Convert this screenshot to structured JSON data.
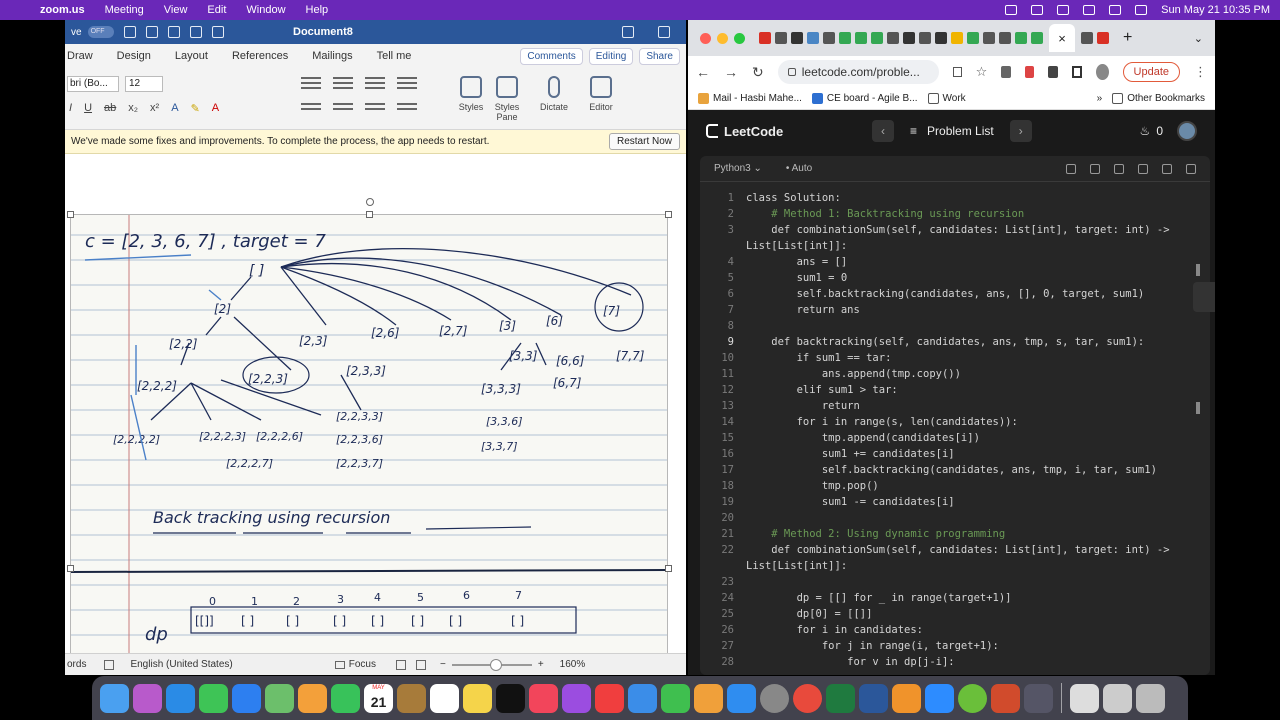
{
  "menubar": {
    "app": "zoom.us",
    "menus": [
      "Meeting",
      "View",
      "Edit",
      "Window",
      "Help"
    ],
    "clock": "Sun May 21  10:35 PM"
  },
  "word": {
    "autosave_label": "ve",
    "toggle": "OFF",
    "doc_title": "Document8",
    "tabs": [
      "Draw",
      "Design",
      "Layout",
      "References",
      "Mailings",
      "Tell me"
    ],
    "comments": "Comments",
    "editing": "Editing",
    "share": "Share",
    "font_name": "bri (Bo...",
    "font_size": "12",
    "big_buttons": {
      "styles": "Styles",
      "styles_pane_1": "Styles",
      "styles_pane_2": "Pane",
      "dictate": "Dictate",
      "editor": "Editor"
    },
    "notice": "We've made some fixes and improvements. To complete the process, the app needs to restart.",
    "restart": "Restart Now",
    "status": {
      "words": "ords",
      "language": "English (United States)",
      "focus": "Focus",
      "zoom": "160%"
    },
    "handwriting": {
      "line1": "c = [2, 3, 6, 7]   , target = 7",
      "root": "[ ]",
      "nodes_row1": [
        "[2]",
        "[2,3]",
        "[2,6]",
        "[2,7]",
        "[3]",
        "[6]",
        "[7]"
      ],
      "nodes_row2": [
        "[2,2]",
        "[2,3,3]",
        "[3,3]",
        "[6,6]",
        "[7,7]"
      ],
      "nodes_row3": [
        "[2,2,2]",
        "[2,2,3]",
        "[3,3,3]",
        "[6,7]"
      ],
      "nodes_row4": [
        "[2,2,2,2]",
        "[2,2,2,3]",
        "[2,2,2,6]",
        "[2,2,3,3]",
        "[3,3,6]"
      ],
      "nodes_row5": [
        "[2,2,2,7]",
        "[2,2,3,6]",
        "[2,2,3,7]",
        "[3,3,7]"
      ],
      "title": "Back tracking using recursion",
      "dp_label": "dp",
      "dp_indices": [
        "0",
        "1",
        "2",
        "3",
        "4",
        "5",
        "6",
        "7"
      ],
      "dp_cells": [
        "[[]]",
        "[ ]",
        "[ ]",
        "[ ]",
        "[ ]",
        "[ ]",
        "[ ]",
        "[ ]"
      ]
    }
  },
  "chrome": {
    "address": "leetcode.com/proble...",
    "update": "Update",
    "bookmarks": [
      "Mail - Hasbi Mahe...",
      "CE board - Agile B...",
      "Work"
    ],
    "other_bookmarks": "Other Bookmarks",
    "colors": {
      "accent": "#e25a3a",
      "tab_green": "#34a853"
    }
  },
  "leetcode": {
    "brand": "LeetCode",
    "problem_list": "Problem List",
    "streak": "0",
    "language": "Python3",
    "mode": "Auto",
    "code_lines": [
      {
        "n": "1",
        "t": "class Solution:"
      },
      {
        "n": "2",
        "t": "    # Method 1: Backtracking using recursion"
      },
      {
        "n": "3",
        "t": "    def combinationSum(self, candidates: List[int], target: int) ->"
      },
      {
        "n": "",
        "t": "List[List[int]]:"
      },
      {
        "n": "4",
        "t": "        ans = []"
      },
      {
        "n": "5",
        "t": "        sum1 = 0"
      },
      {
        "n": "6",
        "t": "        self.backtracking(candidates, ans, [], 0, target, sum1)"
      },
      {
        "n": "7",
        "t": "        return ans"
      },
      {
        "n": "8",
        "t": ""
      },
      {
        "n": "9",
        "t": "    def backtracking(self, candidates, ans, tmp, s, tar, sum1):"
      },
      {
        "n": "10",
        "t": "        if sum1 == tar:"
      },
      {
        "n": "11",
        "t": "            ans.append(tmp.copy())"
      },
      {
        "n": "12",
        "t": "        elif sum1 > tar:"
      },
      {
        "n": "13",
        "t": "            return"
      },
      {
        "n": "14",
        "t": "        for i in range(s, len(candidates)):"
      },
      {
        "n": "15",
        "t": "            tmp.append(candidates[i])"
      },
      {
        "n": "16",
        "t": "            sum1 += candidates[i]"
      },
      {
        "n": "17",
        "t": "            self.backtracking(candidates, ans, tmp, i, tar, sum1)"
      },
      {
        "n": "18",
        "t": "            tmp.pop()"
      },
      {
        "n": "19",
        "t": "            sum1 -= candidates[i]"
      },
      {
        "n": "20",
        "t": ""
      },
      {
        "n": "21",
        "t": "    # Method 2: Using dynamic programming"
      },
      {
        "n": "22",
        "t": "    def combinationSum(self, candidates: List[int], target: int) ->"
      },
      {
        "n": "",
        "t": "List[List[int]]:"
      },
      {
        "n": "23",
        "t": ""
      },
      {
        "n": "24",
        "t": "        dp = [[] for _ in range(target+1)]"
      },
      {
        "n": "25",
        "t": "        dp[0] = [[]]"
      },
      {
        "n": "26",
        "t": "        for i in candidates:"
      },
      {
        "n": "27",
        "t": "            for j in range(i, target+1):"
      },
      {
        "n": "28",
        "t": "                for v in dp[j-i]:"
      }
    ]
  },
  "dock": {
    "calendar_day": "21",
    "calendar_month": "MAY"
  }
}
